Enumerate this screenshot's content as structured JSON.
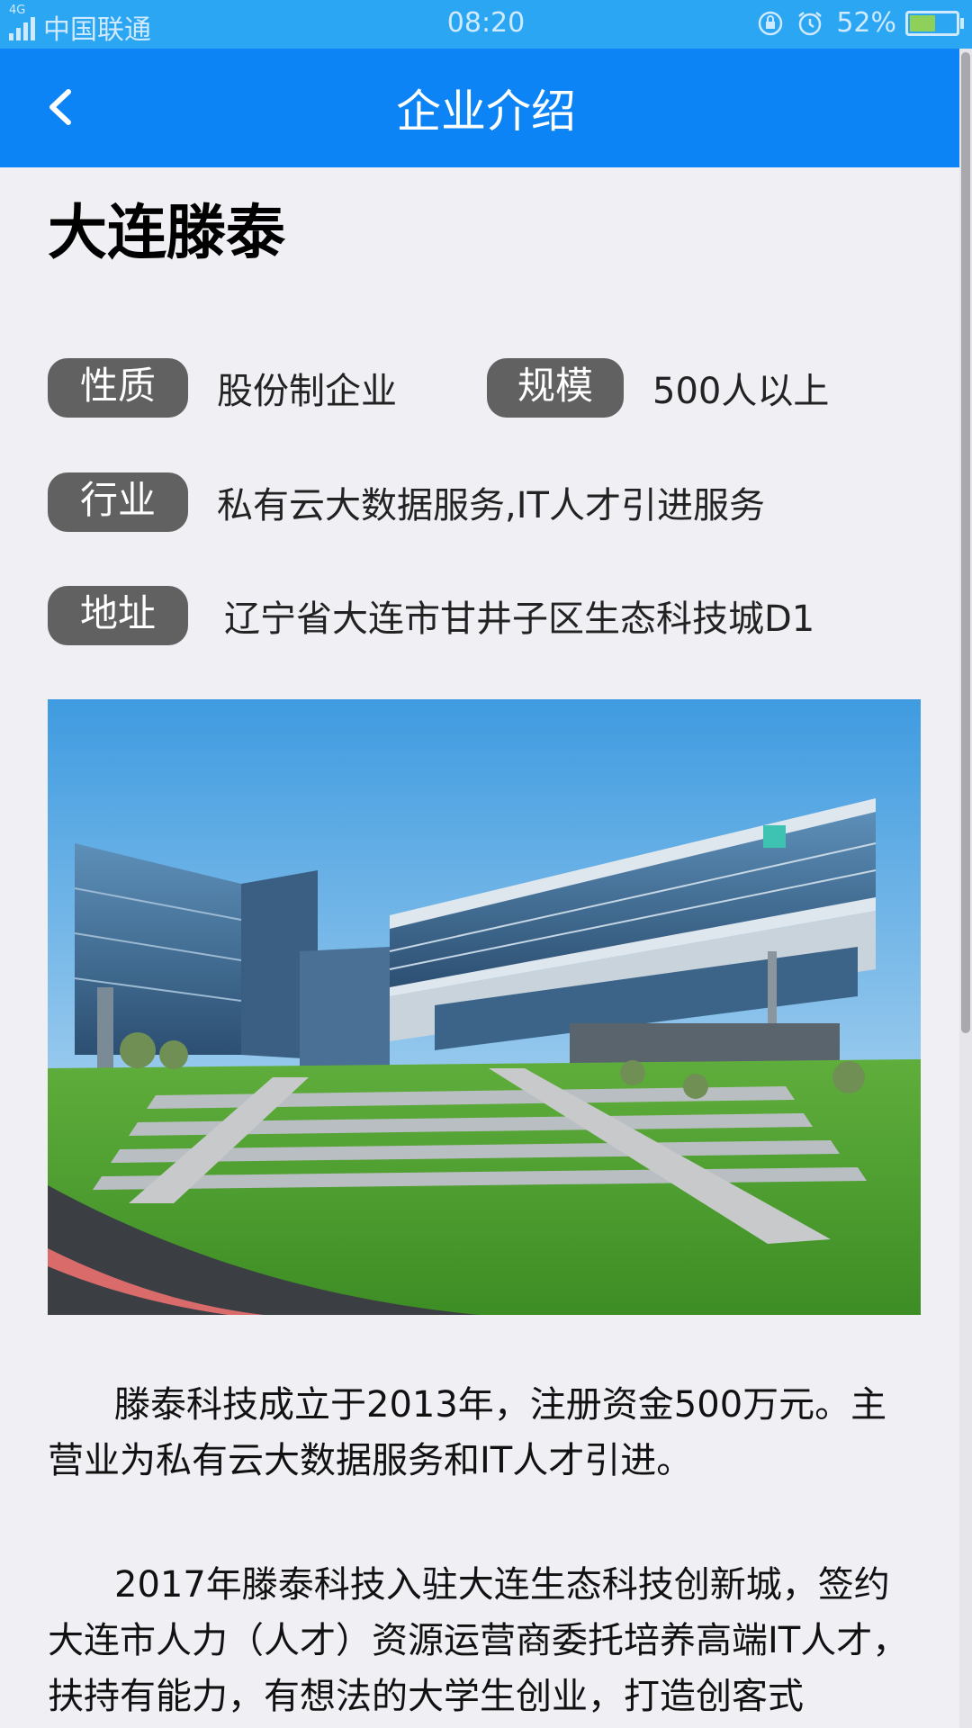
{
  "status_bar": {
    "network": "4G",
    "carrier": "中国联通",
    "time": "08:20",
    "battery": "52%",
    "battery_level": 0.52
  },
  "nav": {
    "title": "企业介绍"
  },
  "company": {
    "name": "大连滕泰",
    "nature_label": "性质",
    "nature_value": "股份制企业",
    "scale_label": "规模",
    "scale_value": "500人以上",
    "industry_label": "行业",
    "industry_value": "私有云大数据服务,IT人才引进服务",
    "address_label": "地址",
    "address_value": "辽宁省大连市甘井子区生态科技城D1"
  },
  "description": {
    "p1": "滕泰科技成立于2013年，注册资金500万元。主营业为私有云大数据服务和IT人才引进。",
    "p2": "2017年滕泰科技入驻大连生态科技创新城，签约大连市人力（人才）资源运营商委托培养高端IT人才，扶持有能力，有想法的大学生创业，打造创客式"
  },
  "colors": {
    "nav": "#0d84f5",
    "status": "#2ba6f2",
    "pill": "#616161",
    "background": "#efeff4"
  }
}
